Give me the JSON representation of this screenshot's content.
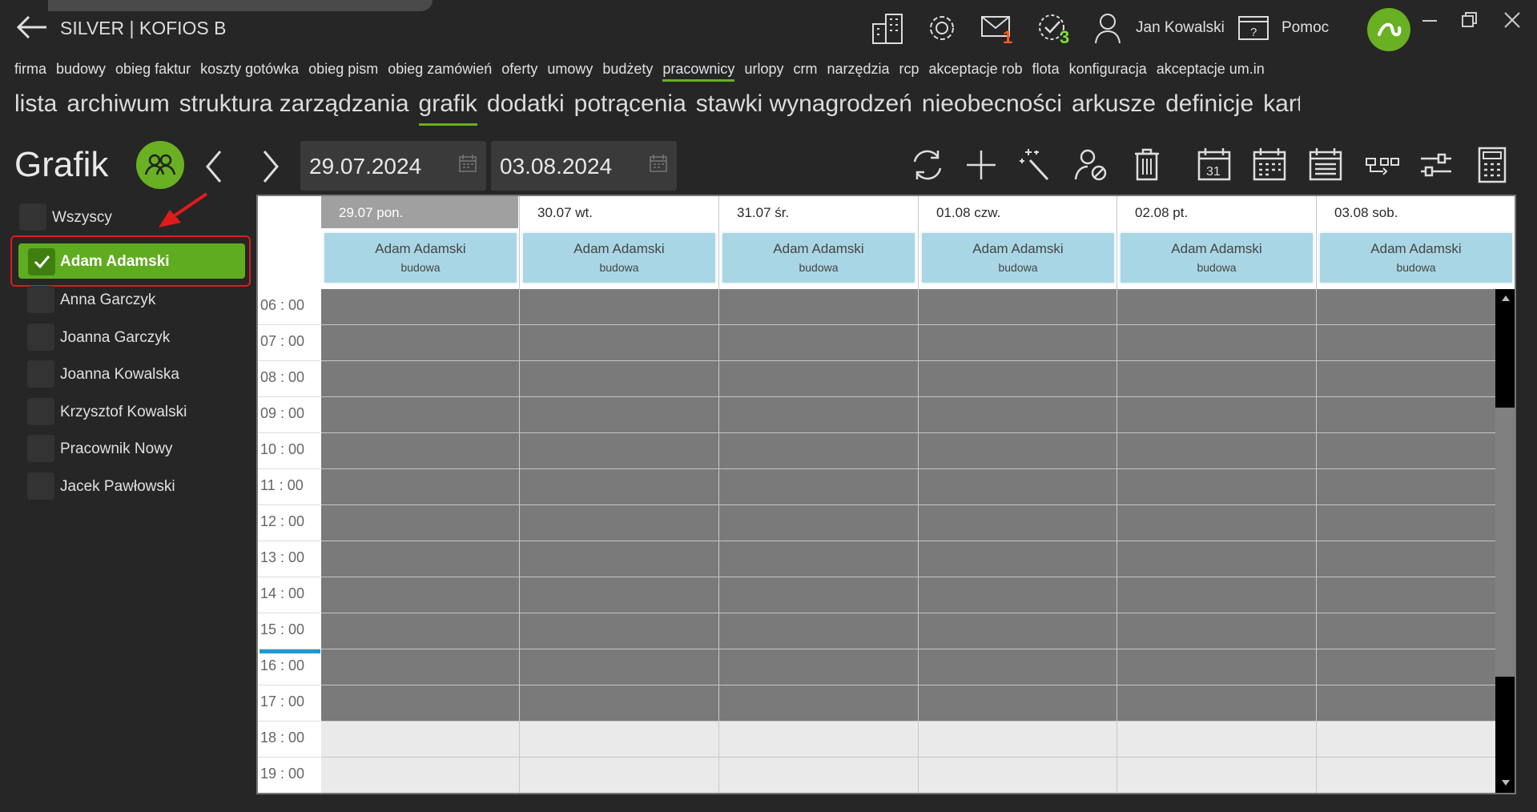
{
  "app_title": "SILVER | KOFIOS B",
  "notifications": {
    "mail_count": "1",
    "tasks_count": "3"
  },
  "user": {
    "name": "Jan Kowalski",
    "help": "Pomoc"
  },
  "nav_main": [
    "firma",
    "budowy",
    "obieg faktur",
    "koszty gotówka",
    "obieg pism",
    "obieg zamówień",
    "oferty",
    "umowy",
    "budżety",
    "pracownicy",
    "urlopy",
    "crm",
    "narzędzia",
    "rcp",
    "akceptacje rob",
    "flota",
    "konfiguracja",
    "akceptacje um.in"
  ],
  "nav_main_active": "pracownicy",
  "nav_sub": [
    "lista",
    "archiwum",
    "struktura zarządzania",
    "grafik",
    "dodatki",
    "potrącenia",
    "stawki wynagrodzeń",
    "nieobecności",
    "arkusze",
    "definicje",
    "karty płatni"
  ],
  "nav_sub_active": "grafik",
  "page_title": "Grafik",
  "date_from": "29.07.2024",
  "date_to": "03.08.2024",
  "employees": {
    "all_label": "Wszyscy",
    "selected": "Adam Adamski",
    "list": [
      "Anna Garczyk",
      "Joanna  Garczyk",
      "Joanna  Kowalska",
      "Krzysztof Kowalski",
      "Pracownik  Nowy",
      "Jacek  Pawłowski"
    ]
  },
  "calendar": {
    "days": [
      "29.07 pon.",
      "30.07 wt.",
      "31.07 śr.",
      "01.08 czw.",
      "02.08 pt.",
      "03.08 sob."
    ],
    "entry_name": "Adam Adamski",
    "entry_role": "budowa",
    "hours": [
      "06 : 00",
      "07 : 00",
      "08 : 00",
      "09 : 00",
      "10 : 00",
      "11 : 00",
      "12 : 00",
      "13 : 00",
      "14 : 00",
      "15 : 00",
      "16 : 00",
      "17 : 00",
      "18 : 00",
      "19 : 00"
    ]
  },
  "colors": {
    "accent": "#6ab023",
    "selection_border": "#e01b1b",
    "card": "#a9d6e5"
  }
}
